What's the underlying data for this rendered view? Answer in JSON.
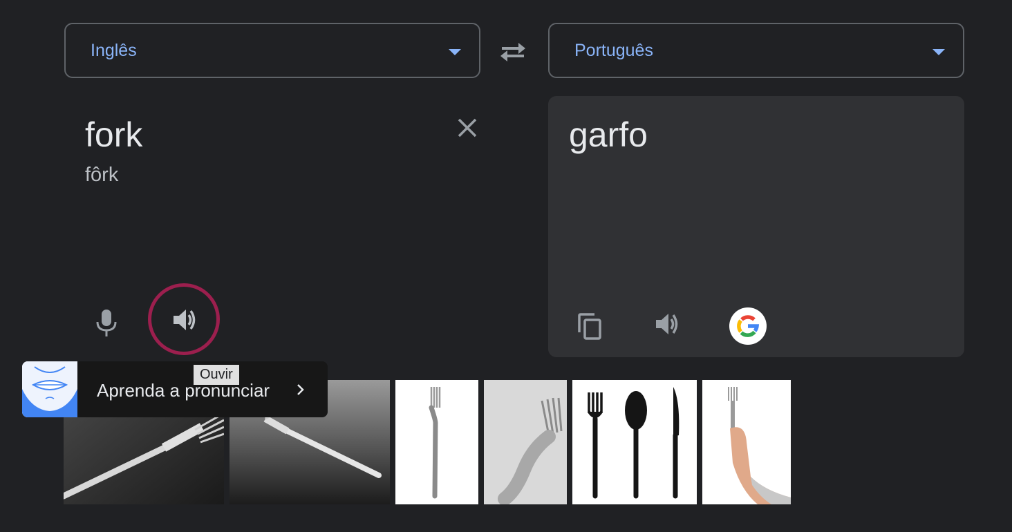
{
  "source_language": {
    "label": "Inglês"
  },
  "target_language": {
    "label": "Português"
  },
  "source": {
    "text": "fork",
    "transliteration": "fôrk"
  },
  "target": {
    "text": "garfo"
  },
  "tooltip": {
    "text": "Ouvir"
  },
  "pronunciation_card": {
    "label": "Aprenda a pronunciar"
  },
  "icons": {
    "dropdown": "caret-down-icon",
    "swap": "swap-languages-icon",
    "clear": "close-icon",
    "mic": "microphone-icon",
    "listen": "speaker-icon",
    "copy": "copy-icon",
    "google": "google-logo-icon",
    "chevron": "chevron-right-icon"
  },
  "colors": {
    "background": "#202124",
    "language_label": "#8ab4f8",
    "target_panel": "#303134",
    "listen_highlight": "#9c1f4e"
  },
  "images": [
    {
      "subject": "fork"
    },
    {
      "subject": "fork"
    },
    {
      "subject": "fork"
    },
    {
      "subject": "fork"
    },
    {
      "subject": "fork, spoon and knife"
    },
    {
      "subject": "hand holding fork"
    }
  ]
}
